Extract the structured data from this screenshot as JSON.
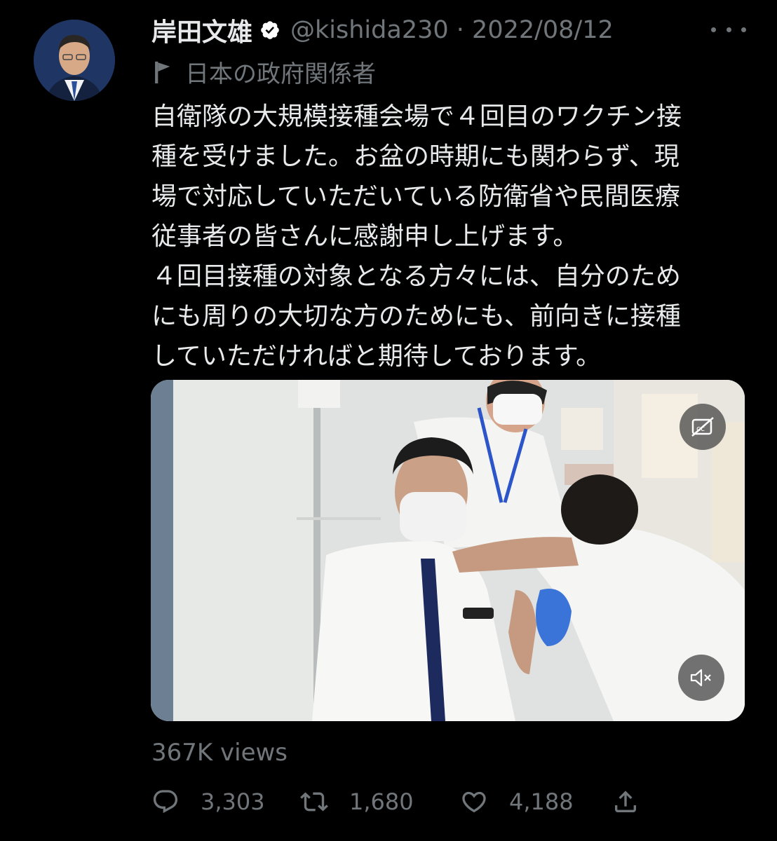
{
  "author": {
    "name": "岸田文雄",
    "handle": "@kishida230",
    "separator": "·",
    "date": "2022/08/12",
    "affiliation": "日本の政府関係者"
  },
  "tweet": {
    "lines": [
      "自衛隊の大規模接種会場で４回目のワクチン接",
      "種を受けました。お盆の時期にも関わらず、現",
      "場で対応していただいている防衛省や民間医療",
      "従事者の皆さんに感謝申し上げます。",
      "４回目接種の対象となる方々には、自分のため",
      "にも周りの大切な方のためにも、前向きに接種",
      "していただければと期待しております。"
    ]
  },
  "media": {
    "type": "video",
    "controls": {
      "captions_icon": "cc-off-icon",
      "mute_icon": "speaker-muted-icon"
    }
  },
  "stats": {
    "views": "367K views",
    "replies": "3,303",
    "reposts": "1,680",
    "likes": "4,188"
  },
  "colors": {
    "background": "#000000",
    "text": "#e7e9ea",
    "secondary": "#71767b",
    "verified": "#ffffff"
  }
}
